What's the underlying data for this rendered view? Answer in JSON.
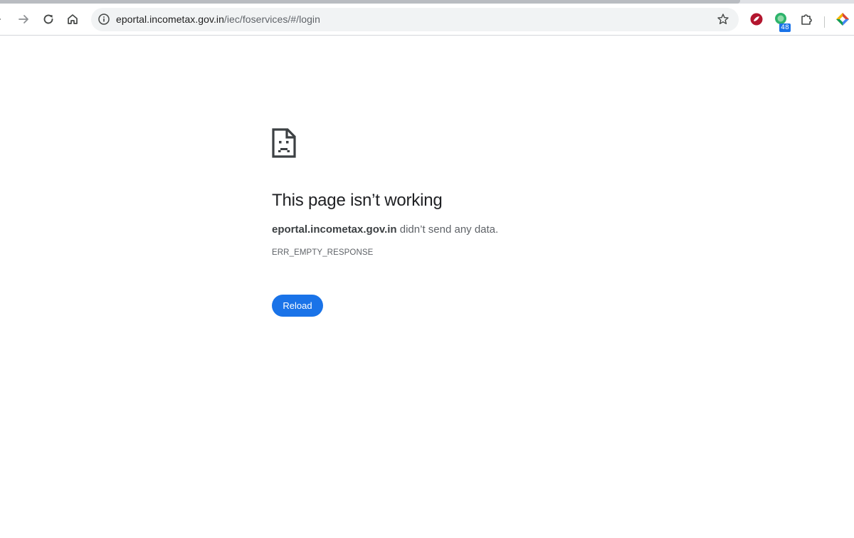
{
  "browser": {
    "address_bar": {
      "url_host": "eportal.incometax.gov.in",
      "url_path": "/iec/foservices/#/login"
    },
    "icons": {
      "back": "arrow-left-icon",
      "forward": "arrow-right-icon",
      "reload": "reload-icon",
      "home": "home-icon",
      "site_info": "info-icon",
      "bookmark": "star-icon",
      "extensions": "puzzle-icon"
    },
    "extension_badge": "48"
  },
  "error_page": {
    "icon": "sad-page-icon",
    "headline": "This page isn’t working",
    "host": "eportal.incometax.gov.in",
    "summary_suffix": " didn’t send any data.",
    "error_code": "ERR_EMPTY_RESPONSE",
    "reload_label": "Reload"
  },
  "colors": {
    "accent": "#1a73e8",
    "text_primary": "#202124",
    "text_secondary": "#5f6368"
  }
}
